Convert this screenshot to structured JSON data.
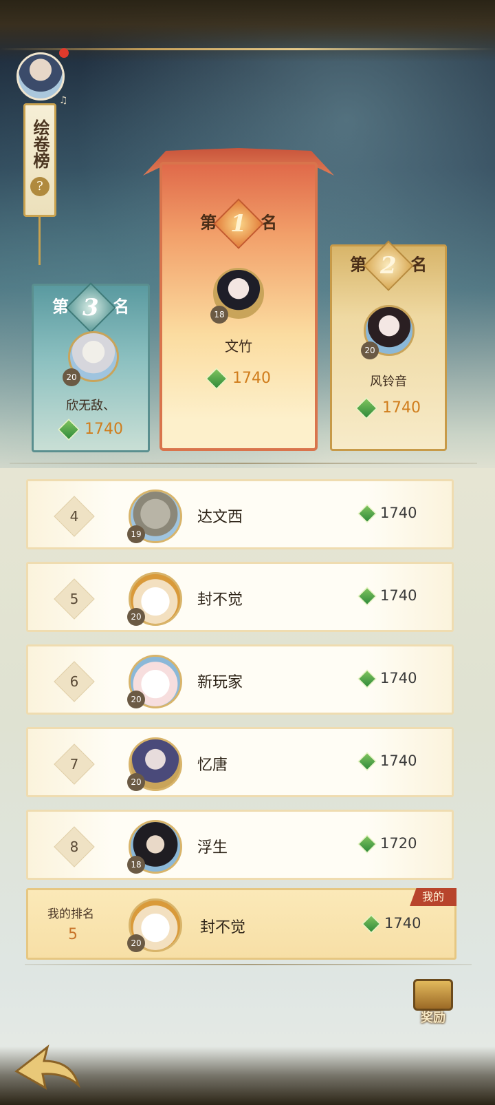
{
  "title": "绘卷榜",
  "help_icon": "question-icon",
  "podium": [
    {
      "rank_prefix": "第",
      "rank": "1",
      "rank_suffix": "名",
      "name": "文竹",
      "level": "18",
      "score": "1740"
    },
    {
      "rank_prefix": "第",
      "rank": "2",
      "rank_suffix": "名",
      "name": "风铃音",
      "level": "20",
      "score": "1740"
    },
    {
      "rank_prefix": "第",
      "rank": "3",
      "rank_suffix": "名",
      "name": "欣无敌、",
      "level": "20",
      "score": "1740"
    }
  ],
  "list": [
    {
      "rank": "4",
      "name": "达文西",
      "level": "19",
      "score": "1740"
    },
    {
      "rank": "5",
      "name": "封不觉",
      "level": "20",
      "score": "1740"
    },
    {
      "rank": "6",
      "name": "新玩家",
      "level": "20",
      "score": "1740"
    },
    {
      "rank": "7",
      "name": "忆唐",
      "level": "20",
      "score": "1740"
    },
    {
      "rank": "8",
      "name": "浮生",
      "level": "18",
      "score": "1720"
    }
  ],
  "me": {
    "label": "我的排名",
    "rank": "5",
    "name": "封不觉",
    "level": "20",
    "score": "1740",
    "badge": "我的"
  },
  "reward_label": "奖励",
  "colors": {
    "score_orange": "#d07d1c",
    "first_panel": "#e06a4a",
    "second_panel": "#d8b56a",
    "third_panel": "#5a9aa0",
    "my_badge": "#b8442c"
  }
}
